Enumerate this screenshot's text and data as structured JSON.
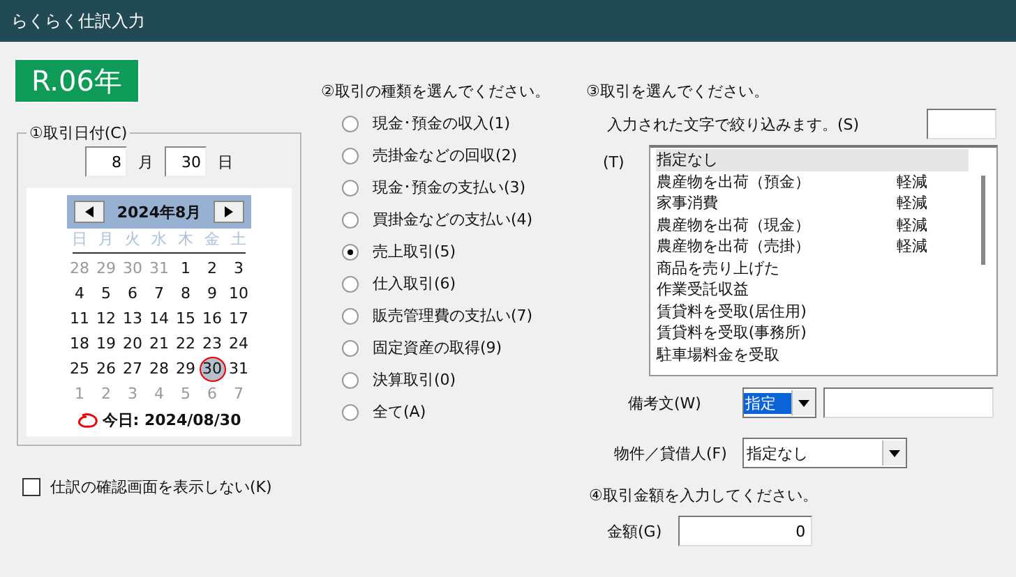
{
  "window": {
    "title": "らくらく仕訳入力"
  },
  "era_badge": "R.06年",
  "date_group": {
    "label": "①取引日付(C)",
    "month": "8",
    "month_unit": "月",
    "day": "30",
    "day_unit": "日",
    "calendar": {
      "title": "2024年8月",
      "weekdays": [
        "日",
        "月",
        "火",
        "水",
        "木",
        "金",
        "土"
      ],
      "weeks": [
        [
          {
            "text": "28",
            "other": true,
            "selected": false
          },
          {
            "text": "29",
            "other": true,
            "selected": false
          },
          {
            "text": "30",
            "other": true,
            "selected": false
          },
          {
            "text": "31",
            "other": true,
            "selected": false
          },
          {
            "text": "1",
            "other": false,
            "selected": false
          },
          {
            "text": "2",
            "other": false,
            "selected": false
          },
          {
            "text": "3",
            "other": false,
            "selected": false
          }
        ],
        [
          {
            "text": "4",
            "other": false,
            "selected": false
          },
          {
            "text": "5",
            "other": false,
            "selected": false
          },
          {
            "text": "6",
            "other": false,
            "selected": false
          },
          {
            "text": "7",
            "other": false,
            "selected": false
          },
          {
            "text": "8",
            "other": false,
            "selected": false
          },
          {
            "text": "9",
            "other": false,
            "selected": false
          },
          {
            "text": "10",
            "other": false,
            "selected": false
          }
        ],
        [
          {
            "text": "11",
            "other": false,
            "selected": false
          },
          {
            "text": "12",
            "other": false,
            "selected": false
          },
          {
            "text": "13",
            "other": false,
            "selected": false
          },
          {
            "text": "14",
            "other": false,
            "selected": false
          },
          {
            "text": "15",
            "other": false,
            "selected": false
          },
          {
            "text": "16",
            "other": false,
            "selected": false
          },
          {
            "text": "17",
            "other": false,
            "selected": false
          }
        ],
        [
          {
            "text": "18",
            "other": false,
            "selected": false
          },
          {
            "text": "19",
            "other": false,
            "selected": false
          },
          {
            "text": "20",
            "other": false,
            "selected": false
          },
          {
            "text": "21",
            "other": false,
            "selected": false
          },
          {
            "text": "22",
            "other": false,
            "selected": false
          },
          {
            "text": "23",
            "other": false,
            "selected": false
          },
          {
            "text": "24",
            "other": false,
            "selected": false
          }
        ],
        [
          {
            "text": "25",
            "other": false,
            "selected": false
          },
          {
            "text": "26",
            "other": false,
            "selected": false
          },
          {
            "text": "27",
            "other": false,
            "selected": false
          },
          {
            "text": "28",
            "other": false,
            "selected": false
          },
          {
            "text": "29",
            "other": false,
            "selected": false
          },
          {
            "text": "30",
            "other": false,
            "selected": true
          },
          {
            "text": "31",
            "other": false,
            "selected": false
          }
        ],
        [
          {
            "text": "1",
            "other": true,
            "selected": false
          },
          {
            "text": "2",
            "other": true,
            "selected": false
          },
          {
            "text": "3",
            "other": true,
            "selected": false
          },
          {
            "text": "4",
            "other": true,
            "selected": false
          },
          {
            "text": "5",
            "other": true,
            "selected": false
          },
          {
            "text": "6",
            "other": true,
            "selected": false
          },
          {
            "text": "7",
            "other": true,
            "selected": false
          }
        ]
      ],
      "today": "今日: 2024/08/30"
    }
  },
  "skip_confirm": {
    "label": "仕訳の確認画面を表示しない(K)",
    "checked": false
  },
  "type_section": {
    "heading": "②取引の種類を選んでください。",
    "options": [
      {
        "label": "現金･預金の収入(1)",
        "selected": false
      },
      {
        "label": "売掛金などの回収(2)",
        "selected": false
      },
      {
        "label": "現金･預金の支払い(3)",
        "selected": false
      },
      {
        "label": "買掛金などの支払い(4)",
        "selected": false
      },
      {
        "label": "売上取引(5)",
        "selected": true
      },
      {
        "label": "仕入取引(6)",
        "selected": false
      },
      {
        "label": "販売管理費の支払い(7)",
        "selected": false
      },
      {
        "label": "固定資産の取得(9)",
        "selected": false
      },
      {
        "label": "決算取引(0)",
        "selected": false
      },
      {
        "label": "全て(A)",
        "selected": false
      }
    ]
  },
  "transaction_section": {
    "heading": "③取引を選んでください。",
    "filter_label": "入力された文字で絞り込みます。(S)",
    "list_label": "(T)",
    "items": [
      {
        "name": "指定なし",
        "selected": true
      },
      {
        "name": "農産物を出荷（預金）",
        "tag": "軽減",
        "selected": false
      },
      {
        "name": "家事消費",
        "tag": "軽減",
        "selected": false
      },
      {
        "name": "農産物を出荷（現金）",
        "tag": "軽減",
        "selected": false
      },
      {
        "name": "農産物を出荷（売掛）",
        "tag": "軽減",
        "selected": false
      },
      {
        "name": "商品を売り上げた",
        "selected": false
      },
      {
        "name": "作業受託収益",
        "selected": false
      },
      {
        "name": "賃貸料を受取(居住用)",
        "selected": false
      },
      {
        "name": "賃貸料を受取(事務所)",
        "selected": false
      },
      {
        "name": "駐車場料金を受取",
        "selected": false
      }
    ]
  },
  "memo": {
    "label": "備考文(W)",
    "combo_value": "指定"
  },
  "property": {
    "label": "物件／貸借人(F)",
    "value": "指定なし"
  },
  "amount_section": {
    "heading": "④取引金額を入力してください。",
    "label": "金額(G)",
    "value": "0"
  }
}
